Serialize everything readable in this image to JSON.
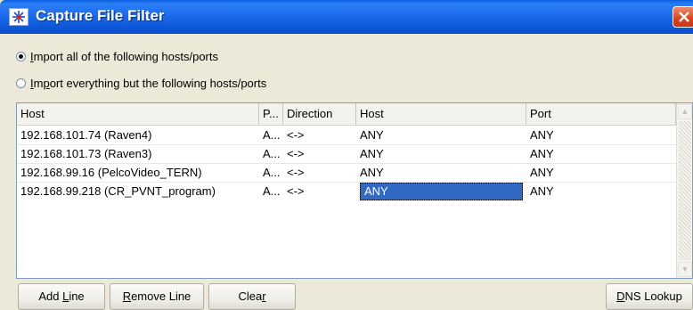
{
  "window": {
    "title": "Capture File Filter",
    "close_symbol": "close-icon"
  },
  "filter_mode": {
    "option_include_pre": "",
    "option_include_ul": "I",
    "option_include_post": "mport all of the following hosts/ports",
    "option_exclude_pre": "",
    "option_exclude_ul": "I",
    "option_exclude_mid": "m",
    "option_exclude_ul2": "p",
    "option_exclude_post": "ort everything but the following hosts/ports",
    "selected": "include"
  },
  "table": {
    "columns": [
      "Host",
      "P...",
      "Direction",
      "Host",
      "Port"
    ],
    "rows": [
      {
        "host": "192.168.101.74 (Raven4)",
        "proto": "A...",
        "direction": "<->",
        "host2": "ANY",
        "port": "ANY"
      },
      {
        "host": "192.168.101.73 (Raven3)",
        "proto": "A...",
        "direction": "<->",
        "host2": "ANY",
        "port": "ANY"
      },
      {
        "host": "192.168.99.16 (PelcoVideo_TERN)",
        "proto": "A...",
        "direction": "<->",
        "host2": "ANY",
        "port": "ANY"
      },
      {
        "host": "192.168.99.218 (CR_PVNT_program)",
        "proto": "A...",
        "direction": "<->",
        "host2": "ANY",
        "port": "ANY"
      }
    ],
    "selected_cell": "row 4, column Host"
  },
  "buttons": {
    "add_line_pre": "Add ",
    "add_line_ul": "L",
    "add_line_post": "ine",
    "remove_line_ul": "R",
    "remove_line_post": "emove Line",
    "clear_pre": "Clea",
    "clear_ul": "r",
    "dns_ul": "D",
    "dns_post": "NS Lookup"
  },
  "colors": {
    "titlebar": "#1f6ff0",
    "selection": "#316ac5",
    "dialog_bg": "#ece9d8"
  }
}
